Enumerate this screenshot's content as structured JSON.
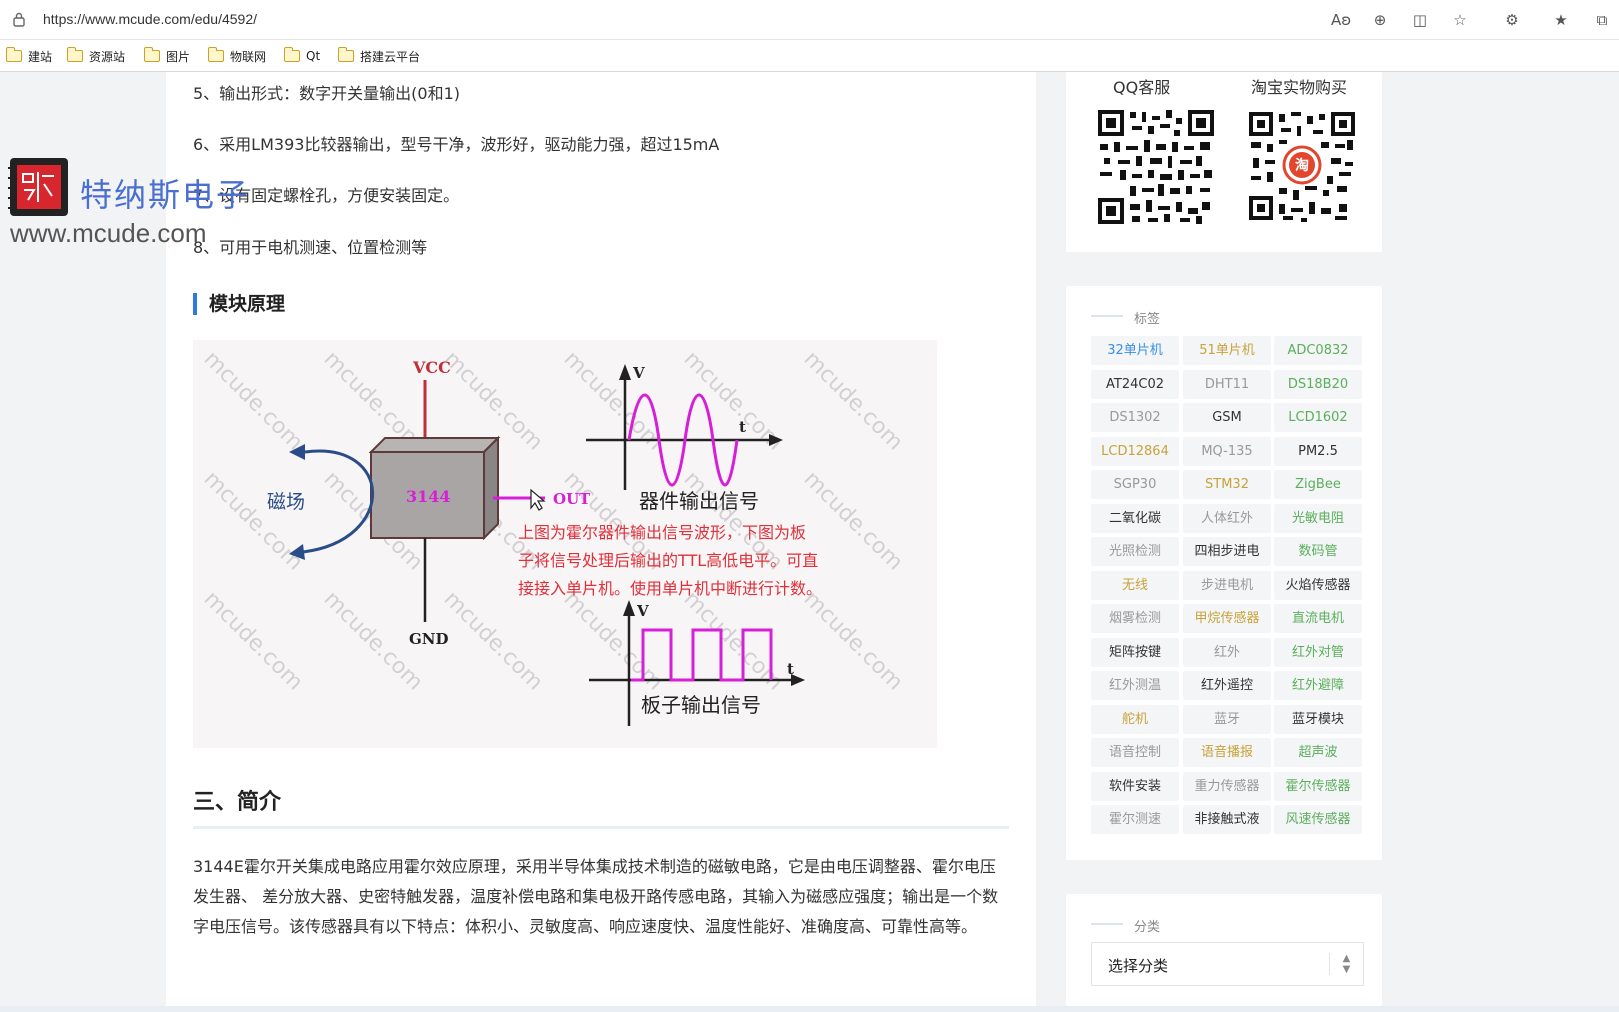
{
  "browser": {
    "url": "https://www.mcude.com/edu/4592/",
    "bookmarks": [
      "建站",
      "资源站",
      "图片",
      "物联网",
      "Qt",
      "搭建云平台"
    ]
  },
  "watermark": {
    "name": "特纳斯电子",
    "url": "www.mcude.com"
  },
  "article": {
    "features": [
      "5、输出形式：数字开关量输出(0和1)",
      "6、采用LM393比较器输出，型号干净，波形好，驱动能力强，超过15mA",
      "7、设有固定螺栓孔，方便安装固定。",
      "8、可用于电机测速、位置检测等"
    ],
    "section_principle": "模块原理",
    "diagram": {
      "vcc": "VCC",
      "gnd": "GND",
      "chip": "3144",
      "field": "磁场",
      "out": "OUT",
      "axis_v": "V",
      "axis_t": "t",
      "device_signal": "器件输出信号",
      "board_signal": "板子输出信号",
      "note_lines": [
        "上图为霍尔器件输出信号波形，下图为板",
        "子将信号处理后输出的TTL高低电平。可直",
        "接接入单片机。使用单片机中断进行计数。"
      ],
      "watermark_text": "mcude.com"
    },
    "section_intro": "三、简介",
    "intro_text": "3144E霍尔开关集成电路应用霍尔效应原理，采用半导体集成技术制造的磁敏电路，它是由电压调整器、霍尔电压发生器、 差分放大器、史密特触发器，温度补偿电路和集电极开路传感电路，其输入为磁感应强度；输出是一个数字电压信号。该传感器具有以下特点：体积小、灵敏度高、响应速度快、温度性能好、准确度高、可靠性高等。"
  },
  "sidebar": {
    "qr_left_title": "QQ客服",
    "qr_right_title": "淘宝实物购买",
    "qr_badge": "淘",
    "tags_label": "标签",
    "tags": [
      {
        "text": "32单片机",
        "color": "#3a8ee6"
      },
      {
        "text": "51单片机",
        "color": "#c8a23a"
      },
      {
        "text": "ADC0832",
        "color": "#5cae5c"
      },
      {
        "text": "AT24C02",
        "color": "#333333"
      },
      {
        "text": "DHT11",
        "color": "#999999"
      },
      {
        "text": "DS18B20",
        "color": "#5cae5c"
      },
      {
        "text": "DS1302",
        "color": "#999999"
      },
      {
        "text": "GSM",
        "color": "#333333"
      },
      {
        "text": "LCD1602",
        "color": "#5cae5c"
      },
      {
        "text": "LCD12864",
        "color": "#c8a23a"
      },
      {
        "text": "MQ-135",
        "color": "#999999"
      },
      {
        "text": "PM2.5",
        "color": "#333333"
      },
      {
        "text": "SGP30",
        "color": "#999999"
      },
      {
        "text": "STM32",
        "color": "#c8a23a"
      },
      {
        "text": "ZigBee",
        "color": "#5cae5c"
      },
      {
        "text": "二氧化碳",
        "color": "#333333"
      },
      {
        "text": "人体红外",
        "color": "#999999"
      },
      {
        "text": "光敏电阻",
        "color": "#5cae5c"
      },
      {
        "text": "光照检测",
        "color": "#999999"
      },
      {
        "text": "四相步进电",
        "color": "#333333"
      },
      {
        "text": "数码管",
        "color": "#5cae5c"
      },
      {
        "text": "无线",
        "color": "#c8a23a"
      },
      {
        "text": "步进电机",
        "color": "#999999"
      },
      {
        "text": "火焰传感器",
        "color": "#333333"
      },
      {
        "text": "烟雾检测",
        "color": "#999999"
      },
      {
        "text": "甲烷传感器",
        "color": "#c8a23a"
      },
      {
        "text": "直流电机",
        "color": "#5cae5c"
      },
      {
        "text": "矩阵按键",
        "color": "#333333"
      },
      {
        "text": "红外",
        "color": "#999999"
      },
      {
        "text": "红外对管",
        "color": "#5cae5c"
      },
      {
        "text": "红外测温",
        "color": "#999999"
      },
      {
        "text": "红外遥控",
        "color": "#333333"
      },
      {
        "text": "红外避障",
        "color": "#5cae5c"
      },
      {
        "text": "舵机",
        "color": "#c8a23a"
      },
      {
        "text": "蓝牙",
        "color": "#999999"
      },
      {
        "text": "蓝牙模块",
        "color": "#333333"
      },
      {
        "text": "语音控制",
        "color": "#999999"
      },
      {
        "text": "语音播报",
        "color": "#c8a23a"
      },
      {
        "text": "超声波",
        "color": "#5cae5c"
      },
      {
        "text": "软件安装",
        "color": "#333333"
      },
      {
        "text": "重力传感器",
        "color": "#999999"
      },
      {
        "text": "霍尔传感器",
        "color": "#5cae5c"
      },
      {
        "text": "霍尔测速",
        "color": "#999999"
      },
      {
        "text": "非接触式液",
        "color": "#333333"
      },
      {
        "text": "风速传感器",
        "color": "#5cae5c"
      }
    ],
    "category_label": "分类",
    "category_select": "选择分类"
  },
  "colors": {
    "accent_blue": "#2c7be5",
    "diagram_red": "#e0303a",
    "diagram_magenta": "#d81fd8"
  }
}
